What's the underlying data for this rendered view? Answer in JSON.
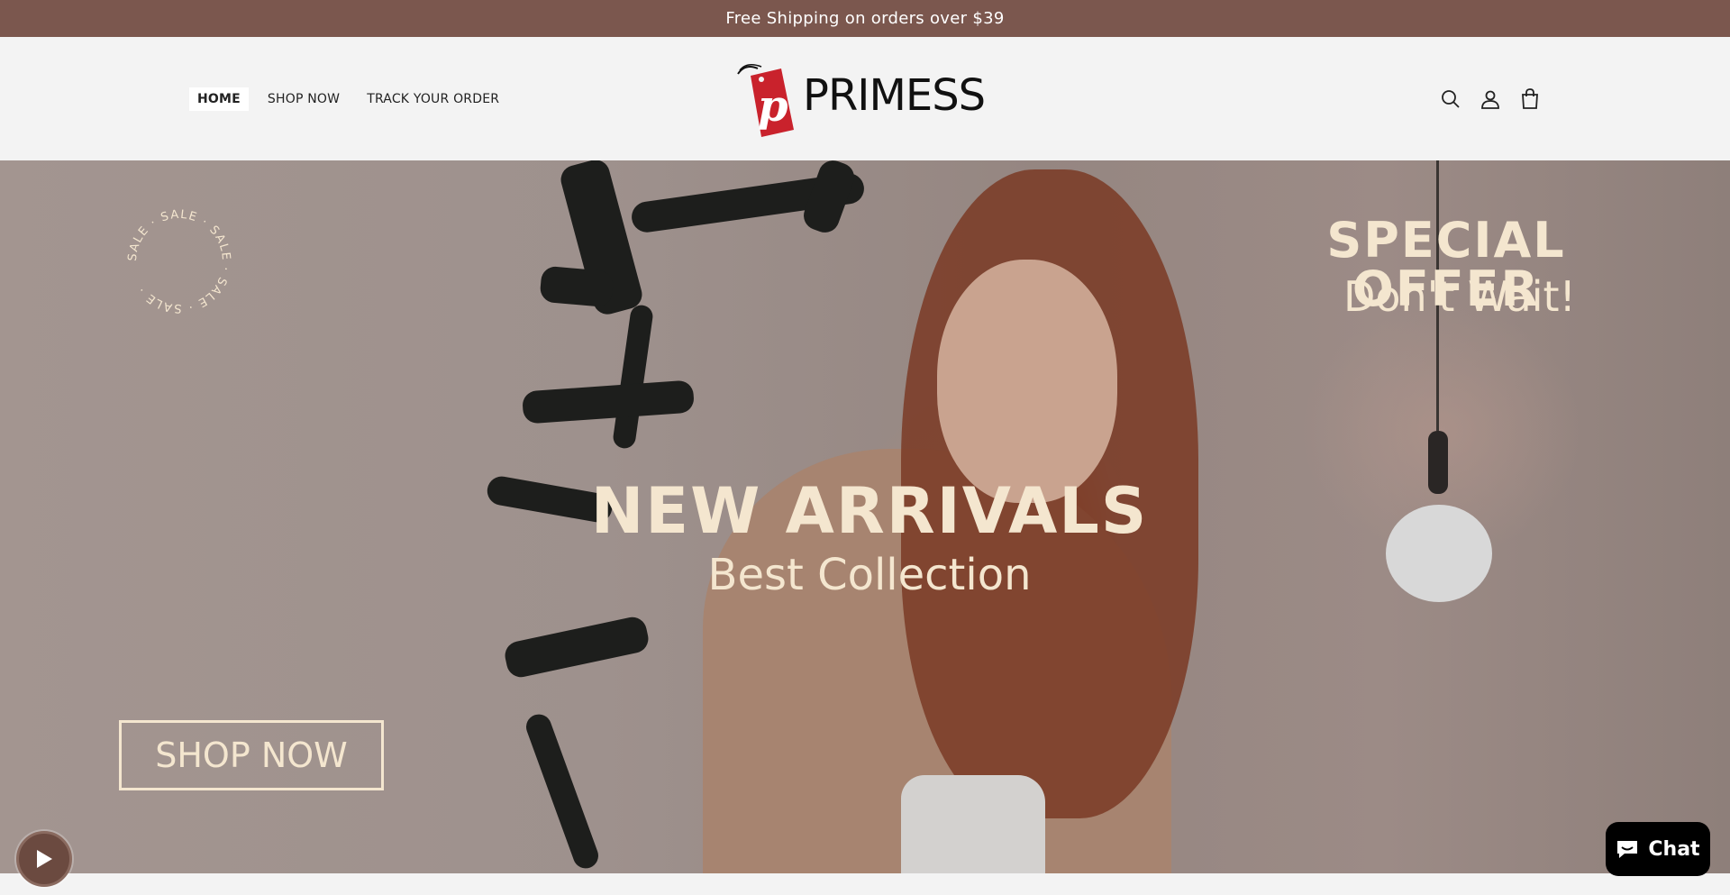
{
  "announcement": {
    "text": "Free Shipping on orders over $39"
  },
  "nav": {
    "items": [
      {
        "label": "HOME",
        "active": true
      },
      {
        "label": "SHOP NOW",
        "active": false
      },
      {
        "label": "TRACK YOUR ORDER",
        "active": false
      }
    ]
  },
  "logo": {
    "letter": "p",
    "word": "PRIMESS"
  },
  "header_icons": [
    "search-icon",
    "account-icon",
    "cart-icon"
  ],
  "hero": {
    "sale_ring_text": "SALE · SALE · SALE · SALE · SALE · ",
    "special_offer": "SPECIAL OFFER",
    "dont_wait": "Don't Wait!",
    "headline": "NEW ARRIVALS",
    "subheadline": "Best Collection",
    "cta_label": "SHOP NOW"
  },
  "chat": {
    "label": "Chat"
  },
  "colors": {
    "announcement_bg": "#7b574e",
    "hero_text": "#f4e6cf",
    "logo_red": "#c9222c",
    "chat_bg": "#000000"
  }
}
